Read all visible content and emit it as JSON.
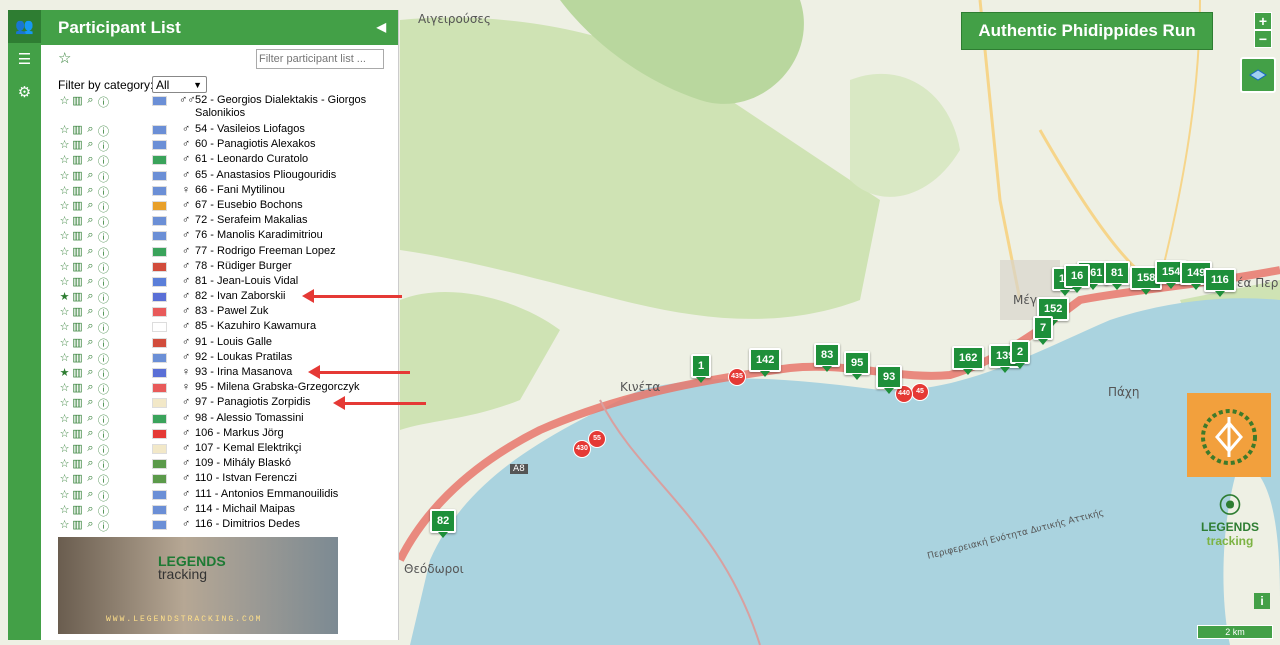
{
  "app": {
    "title": "Authentic Phidippides Run"
  },
  "panel": {
    "title": "Participant List",
    "collapse_icon": "chevron-left-icon",
    "filter_placeholder": "Filter participant list ...",
    "category_label": "Filter by category:",
    "category_value": "All"
  },
  "rail": {
    "items": [
      "users-icon",
      "list-icon",
      "gear-icon"
    ]
  },
  "participants": [
    {
      "label": "52 - Georgios Dialektakis - Giorgos Salonikios",
      "sex": "♂♂",
      "flag": "gr",
      "starred": false
    },
    {
      "label": "54 - Vasileios Liofagos",
      "sex": "♂",
      "flag": "gr",
      "starred": false
    },
    {
      "label": "60 - Panagiotis Alexakos",
      "sex": "♂",
      "flag": "gr",
      "starred": false
    },
    {
      "label": "61 - Leonardo Curatolo",
      "sex": "♂",
      "flag": "it",
      "starred": false
    },
    {
      "label": "65 - Anastasios Pliougouridis",
      "sex": "♂",
      "flag": "gr",
      "starred": false
    },
    {
      "label": "66 - Fani Mytilinou",
      "sex": "♀",
      "flag": "gr",
      "starred": false
    },
    {
      "label": "67 - Eusebio Bochons",
      "sex": "♂",
      "flag": "es",
      "starred": false
    },
    {
      "label": "72 - Serafeim Makalias",
      "sex": "♂",
      "flag": "gr",
      "starred": false
    },
    {
      "label": "76 - Manolis Karadimitriou",
      "sex": "♂",
      "flag": "gr",
      "starred": false
    },
    {
      "label": "77 - Rodrigo Freeman Lopez",
      "sex": "♂",
      "flag": "br",
      "starred": false
    },
    {
      "label": "78 - Rüdiger Burger",
      "sex": "♂",
      "flag": "de",
      "starred": false
    },
    {
      "label": "81 - Jean-Louis Vidal",
      "sex": "♂",
      "flag": "fr",
      "starred": false
    },
    {
      "label": "82 - Ivan Zaborskii",
      "sex": "♂",
      "flag": "ru",
      "starred": true
    },
    {
      "label": "83 - Pawel Zuk",
      "sex": "♂",
      "flag": "pl",
      "starred": false
    },
    {
      "label": "85 - Kazuhiro Kawamura",
      "sex": "♂",
      "flag": "jp",
      "starred": false
    },
    {
      "label": "91 - Louis Galle",
      "sex": "♂",
      "flag": "de",
      "starred": false
    },
    {
      "label": "92 - Loukas Pratilas",
      "sex": "♂",
      "flag": "gr",
      "starred": false
    },
    {
      "label": "93 - Irina Masanova",
      "sex": "♀",
      "flag": "ru",
      "starred": true
    },
    {
      "label": "95 - Milena Grabska-Grzegorczyk",
      "sex": "♀",
      "flag": "pl",
      "starred": false
    },
    {
      "label": "97 - Panagiotis Zorpidis",
      "sex": "♂",
      "flag": "cy",
      "starred": false
    },
    {
      "label": "98 - Alessio Tomassini",
      "sex": "♂",
      "flag": "it",
      "starred": false
    },
    {
      "label": "106 - Markus Jörg",
      "sex": "♂",
      "flag": "ch",
      "starred": false
    },
    {
      "label": "107 - Kemal Elektrikçi",
      "sex": "♂",
      "flag": "cy",
      "starred": false
    },
    {
      "label": "109 - Mihály Blaskó",
      "sex": "♂",
      "flag": "hu",
      "starred": false
    },
    {
      "label": "110 - Istvan Ferenczi",
      "sex": "♂",
      "flag": "hu",
      "starred": false
    },
    {
      "label": "111 - Antonios Emmanouilidis",
      "sex": "♂",
      "flag": "gr",
      "starred": false
    },
    {
      "label": "114 - Michail Maipas",
      "sex": "♂",
      "flag": "gr",
      "starred": false
    },
    {
      "label": "116 - Dimitrios Dedes",
      "sex": "♂",
      "flag": "gr",
      "starred": false
    }
  ],
  "flags": {
    "gr": "#6b8fd6",
    "it": "#3aa35b",
    "es": "#e8a02a",
    "br": "#3aa35b",
    "de": "#d14c3c",
    "fr": "#5b7fd9",
    "ru": "#5a6fd6",
    "pl": "#e85a5a",
    "jp": "#ffffff",
    "cy": "#f2e8c8",
    "ch": "#e53935",
    "hu": "#5b9a4a"
  },
  "ad": {
    "brand_top": "LEGENDS",
    "brand_bottom": "tracking",
    "url": "WWW.LEGENDSTRACKING.COM"
  },
  "map": {
    "markers": [
      "1",
      "142",
      "83",
      "95",
      "93",
      "162",
      "139",
      "152",
      "7",
      "161",
      "81",
      "158",
      "154",
      "149",
      "116",
      "82",
      "14",
      "16",
      "2"
    ],
    "route_labels": [
      "435",
      "430",
      "55",
      "45",
      "440"
    ],
    "places": [
      "Αιγειρούσες",
      "Κινέτα",
      "Μέγ",
      "Νέα Περ",
      "Πάχη",
      "Θεόδωροι",
      "Περιφερειακή Ενότητα Δυτικής Αττικής",
      "A8"
    ],
    "scale": "2 km",
    "zoom_in": "+",
    "zoom_out": "−",
    "info": "i",
    "legend_top": "LEGENDS",
    "legend_bottom": "tracking"
  },
  "accent": "#43a047"
}
